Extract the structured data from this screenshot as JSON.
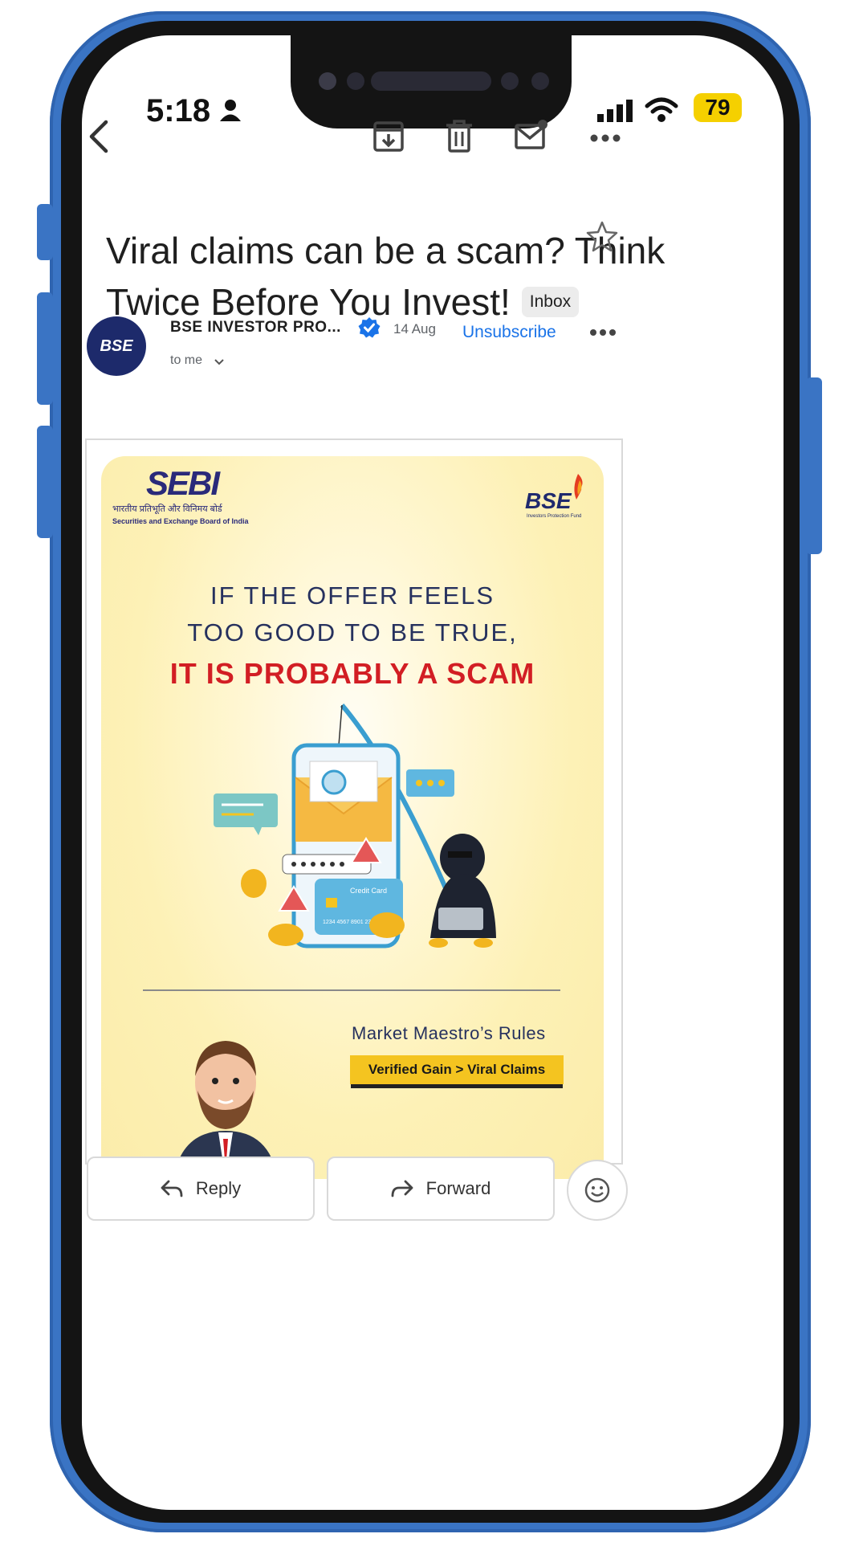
{
  "status_bar": {
    "time": "5:18",
    "battery": "79"
  },
  "email": {
    "subject_line1": "Viral claims can be a scam? Think",
    "subject_line2": "Twice Before You Invest!",
    "label": "Inbox",
    "sender": "BSE INVESTOR PRO...",
    "date": "14 Aug",
    "unsubscribe": "Unsubscribe",
    "recipient": "to me",
    "avatar_text": "BSE"
  },
  "creative": {
    "sebi_logo": "SEBI",
    "sebi_hindi": "भारतीय प्रतिभूति और विनिमय बोर्ड",
    "sebi_english": "Securities and Exchange Board of India",
    "bse_logo": "BSE",
    "bse_tagline": "Investors Protection Fund",
    "headline_1": "IF THE OFFER FEELS",
    "headline_2": "TOO GOOD TO BE TRUE,",
    "headline_3": "IT IS PROBABLY A SCAM",
    "card_label": "Credit Card",
    "card_number": "1234 4567 8901 2345",
    "section_title": "Market Maestro’s Rules",
    "rule_banner": "Verified Gain > Viral Claims"
  },
  "actions": {
    "reply": "Reply",
    "forward": "Forward"
  },
  "colors": {
    "accent_blue": "#1a73e8",
    "scam_red": "#d21e24",
    "banner_yellow": "#f4c420",
    "frame_blue": "#3a74c4"
  },
  "icons": [
    "back-arrow-icon",
    "archive-icon",
    "trash-icon",
    "mark-unread-icon",
    "more-icon",
    "star-icon",
    "verified-badge-icon",
    "chevron-down-icon",
    "reply-icon",
    "forward-icon",
    "emoji-icon"
  ]
}
